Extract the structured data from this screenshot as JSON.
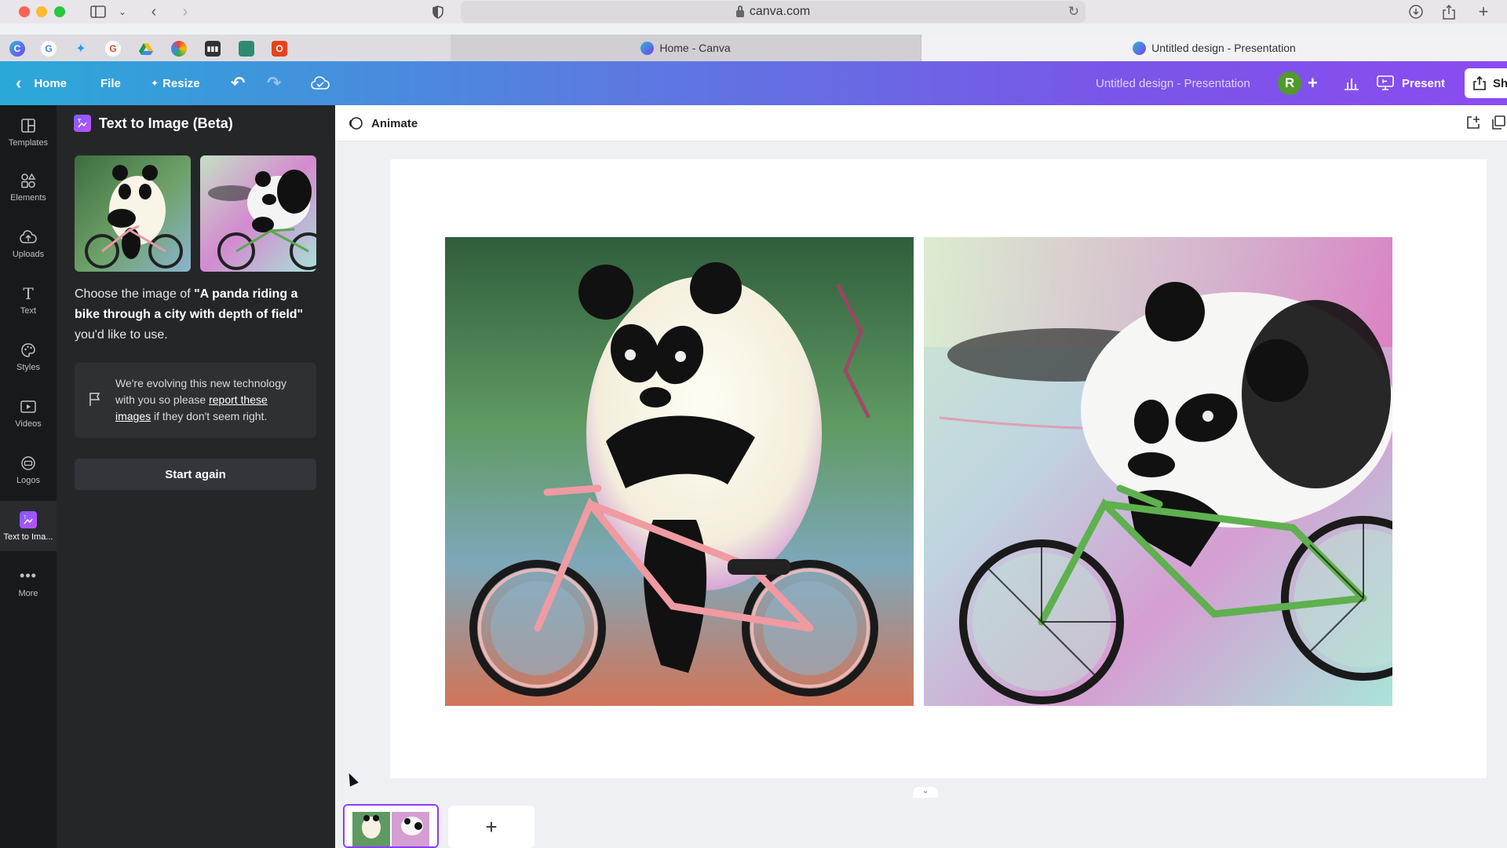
{
  "browser": {
    "url": "canva.com"
  },
  "tabs": [
    {
      "label": "Home - Canva"
    },
    {
      "label": "Untitled design - Presentation"
    }
  ],
  "header": {
    "home": "Home",
    "file": "File",
    "resize": "Resize",
    "title": "Untitled design - Presentation",
    "avatar": "R",
    "present": "Present",
    "share": "Sh"
  },
  "rail": {
    "items": [
      {
        "label": "Templates"
      },
      {
        "label": "Elements"
      },
      {
        "label": "Uploads"
      },
      {
        "label": "Text"
      },
      {
        "label": "Styles"
      },
      {
        "label": "Videos"
      },
      {
        "label": "Logos"
      },
      {
        "label": "Text to Ima..."
      },
      {
        "label": "More"
      }
    ]
  },
  "panel": {
    "title": "Text to Image (Beta)",
    "desc_before": "Choose the image of ",
    "prompt": "\"A panda riding a bike through a city with depth of field\"",
    "desc_after": " you'd like to use.",
    "notice_before": "We're evolving this new technology with you so please ",
    "notice_link": "report these images",
    "notice_after": " if they don't seem right.",
    "start_again": "Start again"
  },
  "editor": {
    "animate": "Animate",
    "add_page": "+"
  },
  "colors": {
    "accent": "#8b3dff",
    "header_start": "#2aa9d8",
    "header_end": "#8a4cf0",
    "panel_bg": "#252628",
    "rail_bg": "#18191b"
  }
}
